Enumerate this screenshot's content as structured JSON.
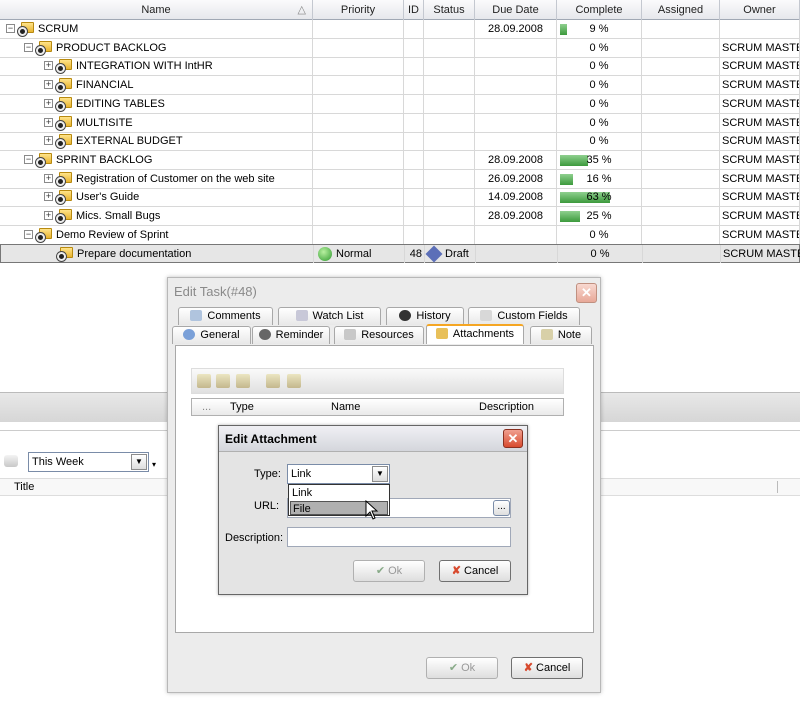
{
  "grid": {
    "columns": [
      "Name",
      "Priority",
      "ID",
      "Status",
      "Due Date",
      "Complete",
      "Assigned",
      "Owner"
    ],
    "sort_indicator": "△",
    "rows": [
      {
        "name": "SCRUM",
        "due": "28.09.2008",
        "complete": "9 %",
        "pct": 9,
        "owner": "",
        "level": 0,
        "toggle": "⊟",
        "priority": "",
        "id": "",
        "status": ""
      },
      {
        "name": "PRODUCT BACKLOG",
        "due": "",
        "complete": "0 %",
        "pct": 0,
        "owner": "SCRUM MASTEF",
        "level": 1,
        "toggle": "⊟",
        "priority": "",
        "id": "",
        "status": ""
      },
      {
        "name": "INTEGRATION WITH IntHR",
        "due": "",
        "complete": "0 %",
        "pct": 0,
        "owner": "SCRUM MASTEF",
        "level": 2,
        "toggle": "⊞",
        "priority": "",
        "id": "",
        "status": ""
      },
      {
        "name": "FINANCIAL",
        "due": "",
        "complete": "0 %",
        "pct": 0,
        "owner": "SCRUM MASTEF",
        "level": 2,
        "toggle": "⊞",
        "priority": "",
        "id": "",
        "status": ""
      },
      {
        "name": "EDITING TABLES",
        "due": "",
        "complete": "0 %",
        "pct": 0,
        "owner": "SCRUM MASTEF",
        "level": 2,
        "toggle": "⊞",
        "priority": "",
        "id": "",
        "status": ""
      },
      {
        "name": "MULTISITE",
        "due": "",
        "complete": "0 %",
        "pct": 0,
        "owner": "SCRUM MASTEF",
        "level": 2,
        "toggle": "⊞",
        "priority": "",
        "id": "",
        "status": ""
      },
      {
        "name": "EXTERNAL BUDGET",
        "due": "",
        "complete": "0 %",
        "pct": 0,
        "owner": "SCRUM MASTEF",
        "level": 2,
        "toggle": "⊞",
        "priority": "",
        "id": "",
        "status": ""
      },
      {
        "name": "SPRINT BACKLOG",
        "due": "28.09.2008",
        "complete": "35 %",
        "pct": 35,
        "owner": "SCRUM MASTEF",
        "level": 1,
        "toggle": "⊟",
        "priority": "",
        "id": "",
        "status": ""
      },
      {
        "name": "Registration of Customer on the web site",
        "due": "26.09.2008",
        "complete": "16 %",
        "pct": 16,
        "owner": "SCRUM MASTEF",
        "level": 2,
        "toggle": "⊞",
        "priority": "",
        "id": "",
        "status": ""
      },
      {
        "name": "User's Guide",
        "due": "14.09.2008",
        "complete": "63 %",
        "pct": 63,
        "owner": "SCRUM MASTEF",
        "level": 2,
        "toggle": "⊞",
        "priority": "",
        "id": "",
        "status": ""
      },
      {
        "name": "Mics. Small Bugs",
        "due": "28.09.2008",
        "complete": "25 %",
        "pct": 25,
        "owner": "SCRUM MASTEF",
        "level": 2,
        "toggle": "⊞",
        "priority": "",
        "id": "",
        "status": ""
      },
      {
        "name": "Demo Review of Sprint",
        "due": "",
        "complete": "0 %",
        "pct": 0,
        "owner": "SCRUM MASTEF",
        "level": 1,
        "toggle": "⊟",
        "priority": "",
        "id": "",
        "status": ""
      },
      {
        "name": "Prepare documentation",
        "due": "",
        "complete": "0 %",
        "pct": 0,
        "owner": "SCRUM MASTEF",
        "level": 2,
        "toggle": "",
        "priority": "Normal",
        "id": "48",
        "status": "Draft",
        "selected": true
      }
    ]
  },
  "filter": {
    "period": "This Week",
    "column": "Title"
  },
  "edit_task": {
    "title": "Edit Task(#48)",
    "tabs_row1": [
      "Comments",
      "Watch List",
      "History",
      "Custom Fields"
    ],
    "tabs_row2": [
      "General",
      "Reminder",
      "Resources",
      "Attachments",
      "Note"
    ],
    "list_columns": [
      "...",
      "Type",
      "Name",
      "Description"
    ],
    "ok": "Ok",
    "cancel": "Cancel"
  },
  "edit_attachment": {
    "title": "Edit Attachment",
    "type_label": "Type:",
    "type_value": "Link",
    "type_options": [
      "Link",
      "File"
    ],
    "url_label": "URL:",
    "browse": "...",
    "description_label": "Description:",
    "ok": "Ok",
    "cancel": "Cancel"
  },
  "colors": {
    "progress": "#4caf50",
    "accent_tab": "#f5a623",
    "close": "#d84a2e"
  }
}
